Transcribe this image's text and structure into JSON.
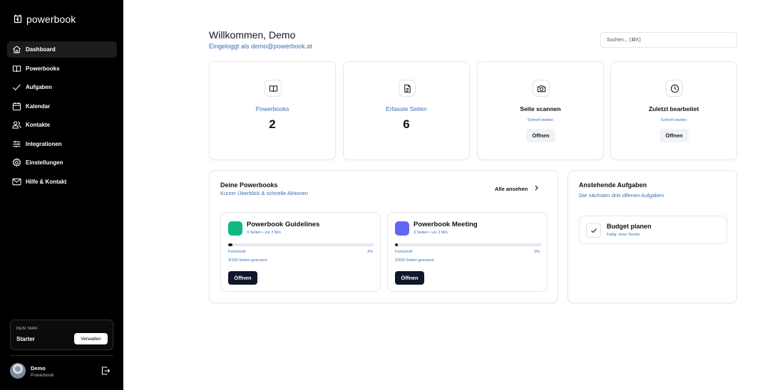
{
  "app": {
    "name": "powerbook"
  },
  "sidebar": {
    "items": [
      {
        "label": "Dashboard",
        "icon": "home-icon",
        "active": true
      },
      {
        "label": "Powerbooks",
        "icon": "book-icon",
        "active": false
      },
      {
        "label": "Aufgaben",
        "icon": "check-icon",
        "active": false
      },
      {
        "label": "Kalendar",
        "icon": "calendar-icon",
        "active": false
      },
      {
        "label": "Kontakte",
        "icon": "users-icon",
        "active": false
      },
      {
        "label": "Integrationen",
        "icon": "sliders-icon",
        "active": false
      },
      {
        "label": "Einstellungen",
        "icon": "gear-icon",
        "active": false
      },
      {
        "label": "Hilfe & Kontakt",
        "icon": "mail-icon",
        "active": false
      }
    ],
    "plan": {
      "caption": "DEIN TARIF",
      "name": "Starter",
      "button": "Verwalten"
    },
    "user": {
      "name": "Demo",
      "subtitle": "Powerbook"
    }
  },
  "header": {
    "title": "Willkommen, Demo",
    "subtitle": "Eingeloggt als demo@powerbook.at",
    "search_placeholder": "Suchen... (⌘K)"
  },
  "stats": [
    {
      "label": "Powerbooks",
      "value": "2",
      "icon": "book-icon"
    },
    {
      "label": "Erfasste Seiten",
      "value": "6",
      "icon": "file-icon"
    },
    {
      "title": "Seite scannen",
      "subtitle": "Schnell starten",
      "button": "Öffnen",
      "icon": "camera-icon"
    },
    {
      "title": "Zuletzt bearbeitet",
      "subtitle": "Schnell starten",
      "button": "Öffnen",
      "icon": "clock-icon"
    }
  ],
  "powerbooks_panel": {
    "title": "Deine Powerbooks",
    "subtitle": "Kurzer Überblick & schnelle Aktionen",
    "view_all": "Alle ansehen",
    "items": [
      {
        "name": "Powerbook Guidelines",
        "meta": "3 Seiten • vor 2 Min",
        "color": "#10b981",
        "progress_label": "Fortschritt",
        "progress_percent": 3,
        "progress_text": "3%",
        "count_text": "3/100 Seiten gescannt",
        "button": "Öffnen"
      },
      {
        "name": "Powerbook Meeting",
        "meta": "3 Seiten • vor 2 Min",
        "color": "#6366f1",
        "progress_label": "Fortschritt",
        "progress_percent": 2,
        "progress_text": "2%",
        "count_text": "3/200 Seiten gescannt",
        "button": "Öffnen"
      }
    ]
  },
  "tasks_panel": {
    "title": "Anstehende Aufgaben",
    "subtitle": "Die nächsten drei offenen Aufgaben",
    "items": [
      {
        "name": "Budget planen",
        "due": "Fällig: ohne Termin"
      }
    ]
  }
}
